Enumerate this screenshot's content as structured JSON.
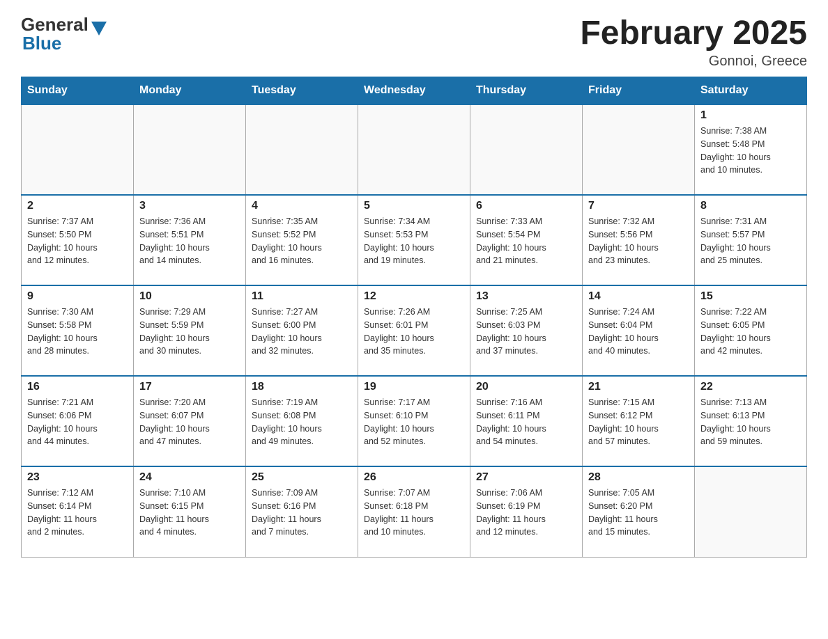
{
  "header": {
    "logo_general": "General",
    "logo_blue": "Blue",
    "month_title": "February 2025",
    "location": "Gonnoi, Greece"
  },
  "weekdays": [
    "Sunday",
    "Monday",
    "Tuesday",
    "Wednesday",
    "Thursday",
    "Friday",
    "Saturday"
  ],
  "weeks": [
    [
      {
        "day": "",
        "info": ""
      },
      {
        "day": "",
        "info": ""
      },
      {
        "day": "",
        "info": ""
      },
      {
        "day": "",
        "info": ""
      },
      {
        "day": "",
        "info": ""
      },
      {
        "day": "",
        "info": ""
      },
      {
        "day": "1",
        "info": "Sunrise: 7:38 AM\nSunset: 5:48 PM\nDaylight: 10 hours\nand 10 minutes."
      }
    ],
    [
      {
        "day": "2",
        "info": "Sunrise: 7:37 AM\nSunset: 5:50 PM\nDaylight: 10 hours\nand 12 minutes."
      },
      {
        "day": "3",
        "info": "Sunrise: 7:36 AM\nSunset: 5:51 PM\nDaylight: 10 hours\nand 14 minutes."
      },
      {
        "day": "4",
        "info": "Sunrise: 7:35 AM\nSunset: 5:52 PM\nDaylight: 10 hours\nand 16 minutes."
      },
      {
        "day": "5",
        "info": "Sunrise: 7:34 AM\nSunset: 5:53 PM\nDaylight: 10 hours\nand 19 minutes."
      },
      {
        "day": "6",
        "info": "Sunrise: 7:33 AM\nSunset: 5:54 PM\nDaylight: 10 hours\nand 21 minutes."
      },
      {
        "day": "7",
        "info": "Sunrise: 7:32 AM\nSunset: 5:56 PM\nDaylight: 10 hours\nand 23 minutes."
      },
      {
        "day": "8",
        "info": "Sunrise: 7:31 AM\nSunset: 5:57 PM\nDaylight: 10 hours\nand 25 minutes."
      }
    ],
    [
      {
        "day": "9",
        "info": "Sunrise: 7:30 AM\nSunset: 5:58 PM\nDaylight: 10 hours\nand 28 minutes."
      },
      {
        "day": "10",
        "info": "Sunrise: 7:29 AM\nSunset: 5:59 PM\nDaylight: 10 hours\nand 30 minutes."
      },
      {
        "day": "11",
        "info": "Sunrise: 7:27 AM\nSunset: 6:00 PM\nDaylight: 10 hours\nand 32 minutes."
      },
      {
        "day": "12",
        "info": "Sunrise: 7:26 AM\nSunset: 6:01 PM\nDaylight: 10 hours\nand 35 minutes."
      },
      {
        "day": "13",
        "info": "Sunrise: 7:25 AM\nSunset: 6:03 PM\nDaylight: 10 hours\nand 37 minutes."
      },
      {
        "day": "14",
        "info": "Sunrise: 7:24 AM\nSunset: 6:04 PM\nDaylight: 10 hours\nand 40 minutes."
      },
      {
        "day": "15",
        "info": "Sunrise: 7:22 AM\nSunset: 6:05 PM\nDaylight: 10 hours\nand 42 minutes."
      }
    ],
    [
      {
        "day": "16",
        "info": "Sunrise: 7:21 AM\nSunset: 6:06 PM\nDaylight: 10 hours\nand 44 minutes."
      },
      {
        "day": "17",
        "info": "Sunrise: 7:20 AM\nSunset: 6:07 PM\nDaylight: 10 hours\nand 47 minutes."
      },
      {
        "day": "18",
        "info": "Sunrise: 7:19 AM\nSunset: 6:08 PM\nDaylight: 10 hours\nand 49 minutes."
      },
      {
        "day": "19",
        "info": "Sunrise: 7:17 AM\nSunset: 6:10 PM\nDaylight: 10 hours\nand 52 minutes."
      },
      {
        "day": "20",
        "info": "Sunrise: 7:16 AM\nSunset: 6:11 PM\nDaylight: 10 hours\nand 54 minutes."
      },
      {
        "day": "21",
        "info": "Sunrise: 7:15 AM\nSunset: 6:12 PM\nDaylight: 10 hours\nand 57 minutes."
      },
      {
        "day": "22",
        "info": "Sunrise: 7:13 AM\nSunset: 6:13 PM\nDaylight: 10 hours\nand 59 minutes."
      }
    ],
    [
      {
        "day": "23",
        "info": "Sunrise: 7:12 AM\nSunset: 6:14 PM\nDaylight: 11 hours\nand 2 minutes."
      },
      {
        "day": "24",
        "info": "Sunrise: 7:10 AM\nSunset: 6:15 PM\nDaylight: 11 hours\nand 4 minutes."
      },
      {
        "day": "25",
        "info": "Sunrise: 7:09 AM\nSunset: 6:16 PM\nDaylight: 11 hours\nand 7 minutes."
      },
      {
        "day": "26",
        "info": "Sunrise: 7:07 AM\nSunset: 6:18 PM\nDaylight: 11 hours\nand 10 minutes."
      },
      {
        "day": "27",
        "info": "Sunrise: 7:06 AM\nSunset: 6:19 PM\nDaylight: 11 hours\nand 12 minutes."
      },
      {
        "day": "28",
        "info": "Sunrise: 7:05 AM\nSunset: 6:20 PM\nDaylight: 11 hours\nand 15 minutes."
      },
      {
        "day": "",
        "info": ""
      }
    ]
  ]
}
